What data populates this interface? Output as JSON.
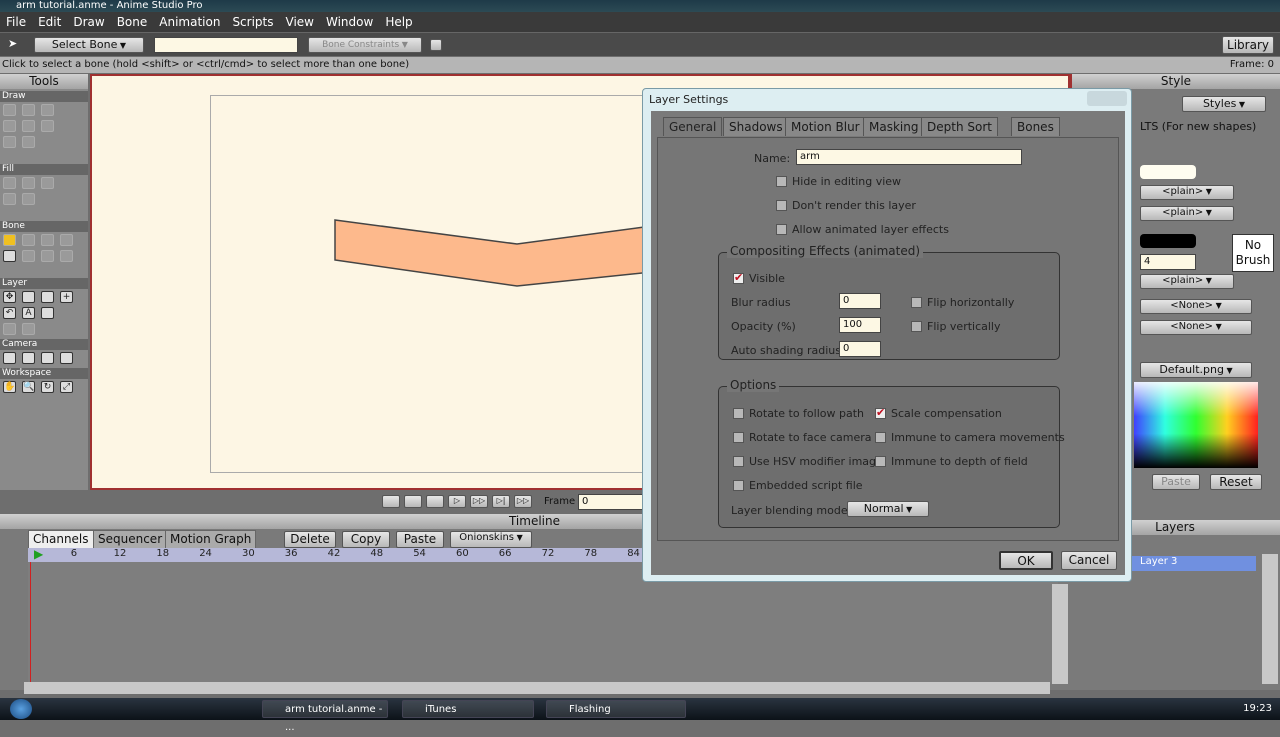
{
  "window": {
    "title": "arm tutorial.anme - Anime Studio Pro"
  },
  "menu": [
    "File",
    "Edit",
    "Draw",
    "Bone",
    "Animation",
    "Scripts",
    "View",
    "Window",
    "Help"
  ],
  "toolbar": {
    "tool_select": "Select Bone",
    "bone_constraints": "Bone Constraints",
    "library": "Library"
  },
  "status": {
    "hint": "Click to select a bone (hold <shift> or <ctrl/cmd> to select more than one bone)",
    "frame": "Frame: 0"
  },
  "tools": {
    "title": "Tools",
    "sections": [
      "Draw",
      "Fill",
      "Bone",
      "Layer",
      "Camera",
      "Workspace"
    ]
  },
  "playback": {
    "frame_label": "Frame",
    "frame_value": "0"
  },
  "timeline": {
    "title": "Timeline",
    "tabs": [
      "Channels",
      "Sequencer",
      "Motion Graph"
    ],
    "buttons": [
      "Delete",
      "Copy",
      "Paste",
      "Onionskins"
    ],
    "ruler": [
      "0",
      "6",
      "12",
      "18",
      "24",
      "30",
      "36",
      "42",
      "48",
      "54",
      "60",
      "66",
      "72",
      "78",
      "84"
    ]
  },
  "style": {
    "title": "Style",
    "styles_btn": "Styles",
    "defaults_text": "LTS (For new shapes)",
    "plain1": "<plain>",
    "plain2": "<plain>",
    "line_width": "4",
    "plain3": "<plain>",
    "no_brush": "No Brush",
    "none1": "<None>",
    "none2": "<None>",
    "palette": "Default.png",
    "paste": "Paste",
    "reset": "Reset",
    "fill_color": "#fffdf0",
    "line_color": "#000000"
  },
  "layers": {
    "title": "Layers",
    "selected": "Layer 3"
  },
  "dialog": {
    "title": "Layer Settings",
    "tabs": [
      "General",
      "Shadows",
      "Motion Blur",
      "Masking",
      "Depth Sort",
      "Bones"
    ],
    "active_tab": "General",
    "name_label": "Name:",
    "name_value": "arm",
    "checks": [
      {
        "label": "Hide in editing view",
        "checked": false
      },
      {
        "label": "Don't render this layer",
        "checked": false
      },
      {
        "label": "Allow animated layer effects",
        "checked": false
      }
    ],
    "compositing": {
      "title": "Compositing Effects (animated)",
      "visible": "Visible",
      "blur_label": "Blur radius",
      "blur": "0",
      "opacity_label": "Opacity (%)",
      "opacity": "100",
      "shading_label": "Auto shading radius",
      "shading": "0",
      "flip_h": "Flip horizontally",
      "flip_v": "Flip vertically"
    },
    "options": {
      "title": "Options",
      "items": [
        {
          "label": "Rotate to follow path",
          "checked": false
        },
        {
          "label": "Scale compensation",
          "checked": true
        },
        {
          "label": "Rotate to face camera",
          "checked": false
        },
        {
          "label": "Immune to camera movements",
          "checked": false
        },
        {
          "label": "Use HSV modifier image",
          "checked": false
        },
        {
          "label": "Immune to depth of field",
          "checked": false
        },
        {
          "label": "Embedded script file",
          "checked": false
        }
      ],
      "blend_label": "Layer blending mode",
      "blend_value": "Normal"
    },
    "ok": "OK",
    "cancel": "Cancel"
  },
  "taskbar": {
    "tasks": [
      "arm tutorial.anme - ...",
      "iTunes",
      "Flashing"
    ],
    "clock": "19:23"
  },
  "colors": {
    "arm_fill": "#fdb98c",
    "canvas": "#fdf6e4",
    "accent_border": "#a03030"
  }
}
